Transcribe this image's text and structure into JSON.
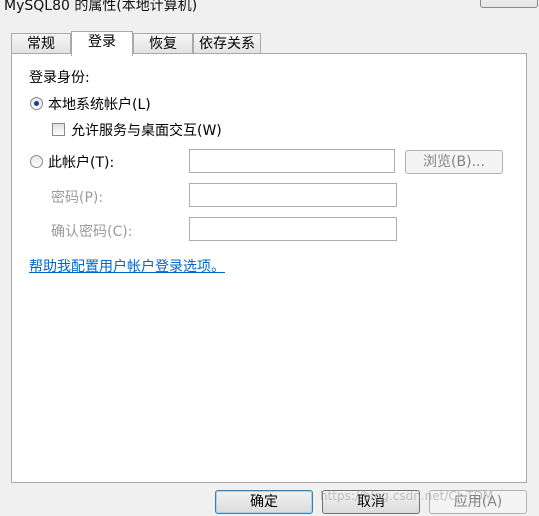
{
  "window": {
    "title": "MySQL80 的属性(本地计算机)"
  },
  "tabs": [
    {
      "label": "常规"
    },
    {
      "label": "登录"
    },
    {
      "label": "恢复"
    },
    {
      "label": "依存关系"
    }
  ],
  "logon": {
    "section_label": "登录身份:",
    "local_system": {
      "label": "本地系统帐户(L)",
      "selected": true
    },
    "interact_desktop": {
      "label": "允许服务与桌面交互(W)",
      "checked": false
    },
    "this_account": {
      "label": "此帐户(T):",
      "selected": false,
      "value": ""
    },
    "browse_label": "浏览(B)...",
    "password": {
      "label": "密码(P):",
      "value": ""
    },
    "confirm_password": {
      "label": "确认密码(C):",
      "value": ""
    },
    "help_link": "帮助我配置用户帐户登录选项。"
  },
  "footer": {
    "ok_label": "确定",
    "cancel_label": "取消",
    "apply_label": "应用(A)"
  },
  "watermark": "https://blog.csdn.net/CJ_TDM"
}
